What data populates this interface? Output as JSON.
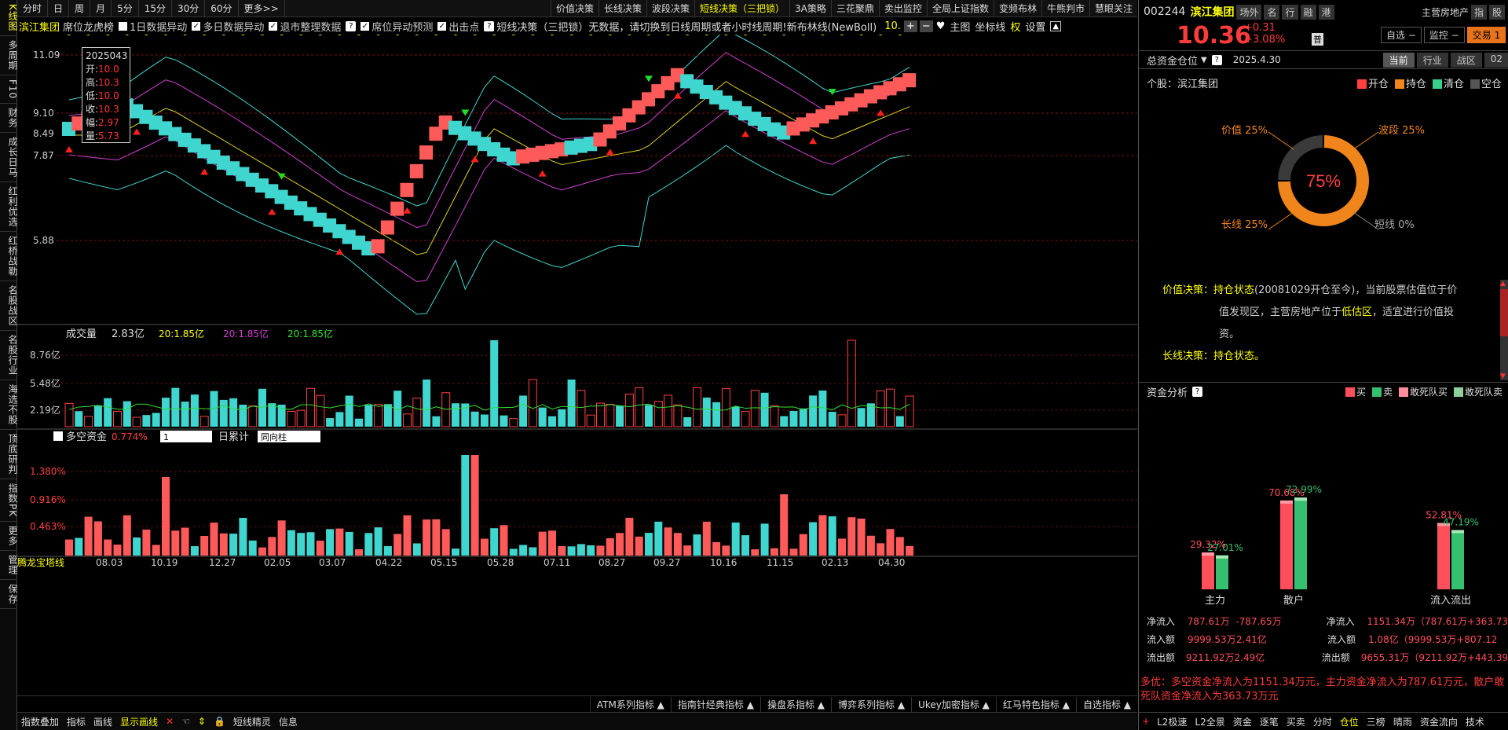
{
  "left_nav": [
    "分时",
    "K线图",
    "多周期",
    "F10",
    "财务",
    "成长日马",
    "红利优选",
    "红桥战勒",
    "名股战区",
    "名股行业",
    "海选不股",
    "顶底研判",
    "指数PK",
    "更多",
    "管理",
    "保存"
  ],
  "topbar": {
    "timeframes": [
      "日",
      "周",
      "月",
      "5分",
      "15分",
      "30分",
      "60分",
      "更多>>"
    ],
    "strategies": [
      "价值决策",
      "长线决策",
      "波段决策",
      "短线决策（三把锁）",
      "3A策略",
      "三花聚鼎",
      "卖出监控",
      "全局上证指数",
      "变频布林",
      "牛熊判市",
      "慧眼关注"
    ]
  },
  "infobar": {
    "name": "滨江集团",
    "board": "席位龙虎榜",
    "checks": [
      "1日数据异动",
      "多日数据异动",
      "退市整理数据",
      "席位异动预测",
      "出击点"
    ],
    "notice": "短线决策（三把锁）无数据，请切换到日线周期或者小时线周期!新布林线(NewBoll)",
    "val": "10.",
    "main": "主图",
    "coord": "坐标线",
    "quan": "权",
    "set": "设置"
  },
  "tooltip": {
    "date": "2025043",
    "rows": [
      [
        "开",
        "10.0"
      ],
      [
        "高",
        "10.3"
      ],
      [
        "低",
        "10.0"
      ],
      [
        "收",
        "10.3"
      ],
      [
        "幅",
        "2.97"
      ],
      [
        "量",
        "5.73"
      ]
    ]
  },
  "price_axis": [
    "11.09",
    "9.10",
    "8.49",
    "7.87",
    "5.88"
  ],
  "volume": {
    "title": "成交量",
    "val": "2.83亿",
    "ma1": "20:1.85亿",
    "ma2": "20:1.85亿",
    "ma3": "20:1.85亿",
    "axis": [
      "8.76亿",
      "5.48亿",
      "2.19亿"
    ]
  },
  "capital": {
    "title": "多空资金",
    "val": "0.774%",
    "sel1": "1",
    "daylab": "日累计",
    "sel2": "同向柱",
    "axis": [
      "1.380%",
      "0.916%",
      "0.463%"
    ]
  },
  "date_axis": [
    "08.03",
    "10.19",
    "12.27",
    "02.05",
    "03.07",
    "04.22",
    "05.15",
    "05.28",
    "07.11",
    "08.27",
    "09.27",
    "10.16",
    "11.15",
    "02.13",
    "04.30"
  ],
  "tower": "腾龙宝塔线",
  "indicator_sets": [
    "ATM系列指标",
    "指南针经典指标",
    "操盘系指标",
    "博弈系列指标",
    "Ukey加密指标",
    "红马特色指标",
    "自选指标"
  ],
  "bottom_tools": [
    "指数叠加",
    "指标",
    "画线",
    "显示画线",
    "短线精灵",
    "信息"
  ],
  "quote": {
    "code": "002244",
    "name": "滨江集团",
    "btns": [
      "场外",
      "名",
      "行",
      "融",
      "港"
    ],
    "sector": "主营房地产",
    "sector_btns": [
      "指",
      "股"
    ],
    "price": "10.36",
    "chg": "+0.31",
    "pct": "+3.08%",
    "badge": "普",
    "ctrl": [
      "自选",
      "监控",
      "交易"
    ]
  },
  "position": {
    "title": "总资金仓位",
    "date": "2025.4.30",
    "tabs": [
      "当前",
      "行业",
      "战区",
      "02"
    ],
    "stock_label": "个股：滨江集团",
    "legend": [
      "开仓",
      "持仓",
      "清仓",
      "空仓"
    ],
    "pct": "75%",
    "labels": {
      "value": "价值 25%",
      "band": "波段 25%",
      "long": "长线 25%",
      "short": "短线 0%"
    },
    "desc_label": "价值决策：",
    "desc_tag": "持仓状态",
    "desc_text1": "(20081029开仓至今)，当前股票估值位于价",
    "desc_text2": "值发现区，主营房地产位于",
    "desc_hl": "低估区",
    "desc_text3": "，适宜进行价值投",
    "desc_text4": "资。",
    "long_label": "长线决策：",
    "long_tag": "持仓状态。"
  },
  "fund": {
    "title": "资金分析",
    "legend": [
      "买",
      "卖",
      "敢死队买",
      "敢死队卖"
    ],
    "bars": [
      {
        "label": "主力",
        "buy": 29.32,
        "sell": 27.01
      },
      {
        "label": "散户",
        "buy": 70.68,
        "sell": 72.99
      },
      {
        "label": "流入流出",
        "buy": 52.81,
        "sell": 47.19
      }
    ],
    "buy_lbl": [
      "29.32%",
      "70.68%",
      "52.81%"
    ],
    "sell_lbl": [
      "27.01%",
      "72.99%",
      "47.19%"
    ],
    "rows_left": [
      [
        "净流入",
        "787.61万",
        "-787.65万"
      ],
      [
        "流入额",
        "9999.53万",
        "2.41亿"
      ],
      [
        "流出额",
        "9211.92万",
        "2.49亿"
      ]
    ],
    "rows_right": [
      [
        "净流入",
        "1151.34万（787.61万+363.73"
      ],
      [
        "流入额",
        "1.08亿（9999.53万+807.12"
      ],
      [
        "流出额",
        "9655.31万（9211.92万+443.39"
      ]
    ],
    "summary": "多优：多空资金净流入为1151.34万元，主力资金净流入为787.61万元，散户敢死队资金净流入为363.73万元"
  },
  "footer_tabs": [
    "L2极速",
    "L2全景",
    "资金",
    "逐笔",
    "买卖",
    "分时",
    "仓位",
    "三榜",
    "晴雨",
    "资金流向",
    "技术"
  ],
  "colors": {
    "up": "#ff3b3b",
    "down": "#3fd6d0",
    "yellow": "#ffff00",
    "bg": "#000000"
  }
}
